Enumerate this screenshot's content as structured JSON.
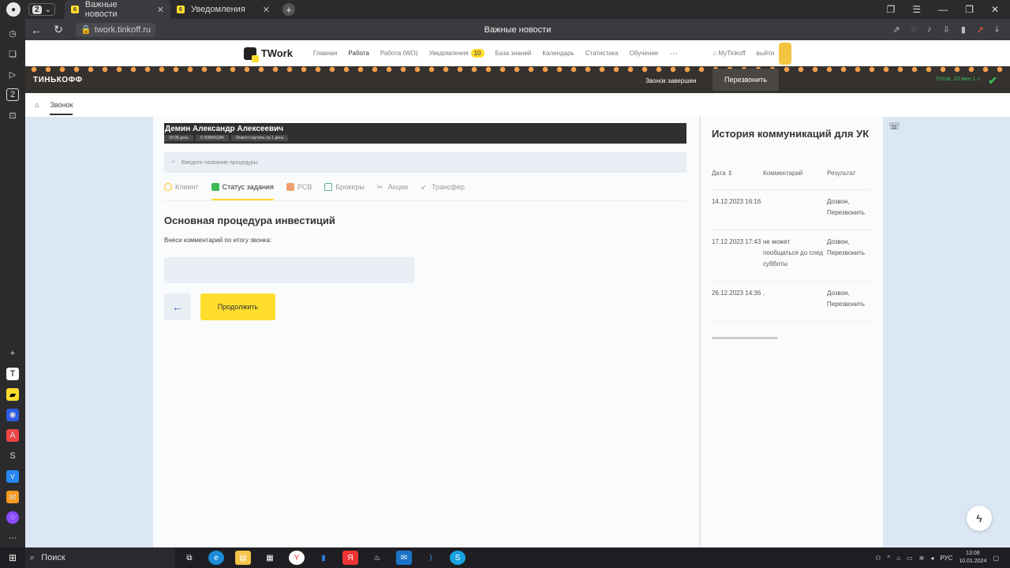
{
  "browser": {
    "tab_count": "2",
    "tabs": [
      {
        "badge": "6",
        "label": "Важные новости"
      },
      {
        "badge": "6",
        "label": "Уведомления"
      }
    ],
    "url": "twork.tinkoff.ru",
    "page_title": "Важные новости"
  },
  "topnav": {
    "logo": "TWork",
    "items": [
      "Главная",
      "Работа",
      "Работа (WO)",
      "Уведомления",
      "База знаний",
      "Календарь",
      "Статистика",
      "Обучение",
      "···"
    ],
    "notif_count": "10",
    "mytinkoff": "MyTinkoff",
    "logout": "выйти"
  },
  "banner": {
    "brand": "ТИНЬКОФФ",
    "call_state": "Звонок завершен",
    "recall": "Перезвонить",
    "ready_status": "Готов, 23 мин 1 с"
  },
  "breadcrumb": {
    "current": "Звонок"
  },
  "client": {
    "name": "Демин Александр Алексеевич",
    "chips": [
      "16:08 день",
      "5-3I3MI4QAK",
      "Инвест наутиль на 1 день"
    ]
  },
  "search": {
    "placeholder": "Введите название процедуры"
  },
  "tabs": [
    "Клиент",
    "Статус задания",
    "PCB",
    "Брокеры",
    "Акции",
    "Трансфер"
  ],
  "procedure": {
    "title": "Основная процедура инвестиций",
    "hint": "Внеси комментарий по итогу звонка:",
    "continue": "Продолжить"
  },
  "history": {
    "title": "История коммуникаций для УК",
    "headers": [
      "Дата ⇕",
      "Комментарий",
      "Результат"
    ],
    "rows": [
      {
        "date": "14.12.2023 16:16",
        "comment": "",
        "result": "Дозвон, Перезвонить"
      },
      {
        "date": "17.12.2023 17:43",
        "comment": "не может пообщаться до след субботы",
        "result": "Дозвон, Перезвонить"
      },
      {
        "date": "26.12.2023 14:36",
        "comment": ",",
        "result": "Дозвон, Перезвонить"
      }
    ]
  },
  "taskbar": {
    "search_label": "Поиск",
    "lang": "РУС",
    "time": "13:08",
    "date": "10.01.2024"
  }
}
